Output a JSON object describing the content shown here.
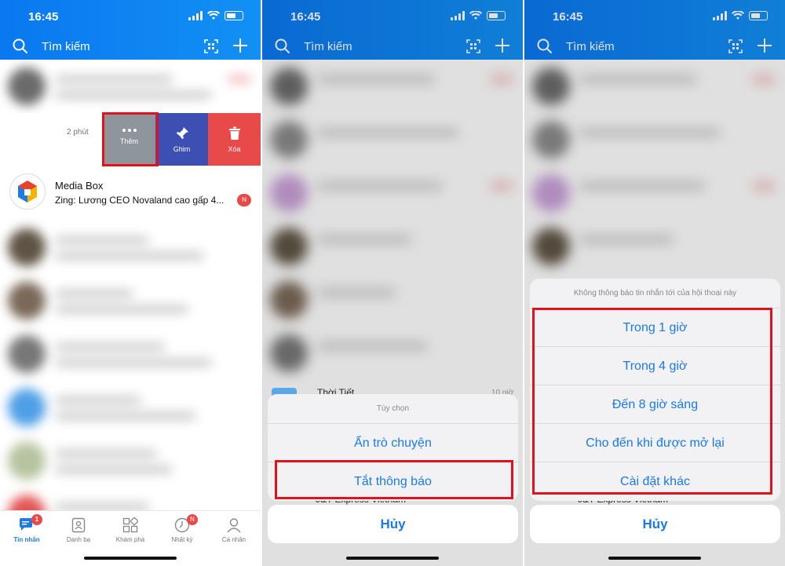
{
  "status": {
    "time": "16:45"
  },
  "header": {
    "search_placeholder": "Tìm kiếm"
  },
  "panel1": {
    "swipe_time": "2 phút",
    "actions": {
      "more": "Thêm",
      "pin": "Ghim",
      "delete": "Xóa"
    },
    "conversation": {
      "name": "Media Box",
      "preview": "Zing: Lương CEO Novaland cao gấp 4...",
      "badge": "N"
    },
    "bottom_nav": [
      {
        "label": "Tin nhắn",
        "badge": "1"
      },
      {
        "label": "Danh bạ"
      },
      {
        "label": "Khám phá"
      },
      {
        "label": "Nhật ký",
        "badge": "N"
      },
      {
        "label": "Cá nhân"
      }
    ]
  },
  "panel2": {
    "peek_name": "Thời Tiết",
    "peek_time": "10 giờ",
    "peek_bottom": "J&T Express Vietnam",
    "sheet_title": "Tùy chọn",
    "options": [
      "Ẩn trò chuyện",
      "Tắt thông báo"
    ],
    "cancel": "Hủy"
  },
  "panel3": {
    "peek_bottom": "J&T Express Vietnam",
    "sheet_title": "Không thông báo tin nhắn tới của hội thoại này",
    "options": [
      "Trong 1 giờ",
      "Trong 4 giờ",
      "Đến 8 giờ sáng",
      "Cho đến khi được mở lại",
      "Cài đặt khác"
    ],
    "cancel": "Hủy"
  },
  "colors": {
    "brand": "#0a78f0",
    "accent_text": "#1a7ae6",
    "highlight": "#e0131d",
    "danger": "#e84a4a",
    "pin": "#3d4fb3"
  }
}
